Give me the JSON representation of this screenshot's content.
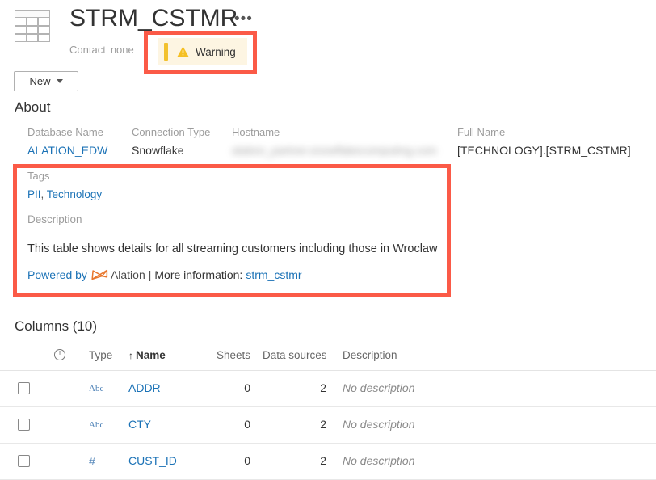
{
  "header": {
    "table_icon": "table-grid-icon",
    "title": "STRM_CSTMR",
    "overflow_menu": "•••",
    "contact_label": "Contact",
    "contact_value": "none",
    "warning_badge": {
      "icon": "warning-triangle-icon",
      "label": "Warning",
      "bar_color": "#f2c12e",
      "background_color": "#fdf5e2"
    },
    "new_button": {
      "label": "New",
      "caret": "chevron-down-icon"
    }
  },
  "about": {
    "heading": "About",
    "fields": [
      {
        "label": "Database Name",
        "value": "ALATION_EDW",
        "is_link": true
      },
      {
        "label": "Connection Type",
        "value": "Snowflake",
        "is_link": false
      },
      {
        "label": "Hostname",
        "value": "alation_partner.snowflakecomputing.com",
        "is_link": false,
        "redacted": true
      },
      {
        "label": "Full Name",
        "value": "[TECHNOLOGY].[STRM_CSTMR]",
        "is_link": false
      }
    ],
    "tags": {
      "label": "Tags",
      "items": [
        "PII",
        "Technology"
      ],
      "separator": ","
    },
    "description": {
      "label": "Description",
      "text": "This table shows details for all streaming customers including those in Wroclaw",
      "footer": {
        "powered_by": "Powered by",
        "logo": "alation-bowtie-logo",
        "brand": "Alation",
        "pipe": "|",
        "more_info_label": "More information:",
        "more_info_link": "strm_cstmr"
      }
    }
  },
  "columns_section": {
    "heading": "Columns (10)",
    "count": 10,
    "headers": {
      "warn": "warning-circle-icon",
      "type": "Type",
      "name": "Name",
      "name_sort_arrow": "↑",
      "sheets": "Sheets",
      "data_sources": "Data sources",
      "description": "Description"
    },
    "rows": [
      {
        "checked": false,
        "type_icon": "Abc",
        "type_kind": "text",
        "name": "ADDR",
        "sheets": "0",
        "data_sources": "2",
        "description": "No description"
      },
      {
        "checked": false,
        "type_icon": "Abc",
        "type_kind": "text",
        "name": "CTY",
        "sheets": "0",
        "data_sources": "2",
        "description": "No description"
      },
      {
        "checked": false,
        "type_icon": "#",
        "type_kind": "number",
        "name": "CUST_ID",
        "sheets": "0",
        "data_sources": "2",
        "description": "No description"
      }
    ]
  },
  "annotations": {
    "color": "#fb5a47",
    "boxes": [
      "warning-badge-highlight",
      "tags-description-highlight"
    ]
  }
}
